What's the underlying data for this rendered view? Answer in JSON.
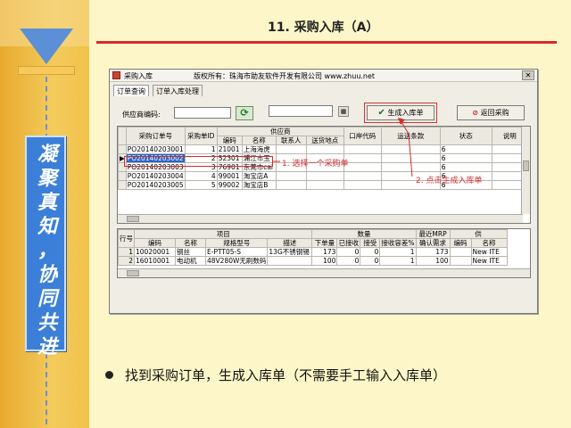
{
  "slide": {
    "title": "11. 采购入库（A）",
    "side_text": [
      "凝",
      "聚",
      "真",
      "知",
      "，",
      "协",
      "同",
      "共",
      "进"
    ],
    "bullet": "找到采购订单，生成入库单（不需要手工输入入库单）"
  },
  "window": {
    "title": "采购入库",
    "copyright": "版权所有：珠海市助友软件开发有限公司 www.zhuu.net",
    "close_glyph": "✕",
    "tabs": [
      "订单查询",
      "订单入库处理"
    ],
    "supplier_label": "供应商编码:",
    "generate_button": "生成入库单",
    "back_button": "返回采购",
    "icons": {
      "refresh": "refresh-icon",
      "calendar": "calendar-icon",
      "check": "check-icon",
      "stop": "stop-icon"
    }
  },
  "orders": {
    "group_header": "供应商",
    "columns": [
      "采购订单号",
      "采购单ID",
      "编码",
      "名称",
      "联系人",
      "送货地点",
      "口岸代码",
      "运送条款",
      "状态",
      "说明"
    ],
    "rows": [
      [
        "PO20140203001",
        "1",
        "21001",
        "上海海虎",
        "",
        "",
        "",
        "",
        "6",
        ""
      ],
      [
        "PO20140203002",
        "2",
        "52301",
        "浦江市玉",
        "",
        "",
        "",
        "",
        "6",
        ""
      ],
      [
        "PO20140203003",
        "3",
        "76901",
        "东莞市cai",
        "",
        "",
        "",
        "",
        "6",
        ""
      ],
      [
        "PO20140203004",
        "4",
        "99001",
        "淘宝店A",
        "",
        "",
        "",
        "",
        "6",
        ""
      ],
      [
        "PO20140203005",
        "5",
        "99002",
        "淘宝店B",
        "",
        "",
        "",
        "",
        "6",
        ""
      ]
    ],
    "selected_row": 1
  },
  "items": {
    "group_headers": [
      "项目",
      "数量",
      "最近MRP",
      "供"
    ],
    "columns": [
      "行号",
      "编码",
      "名称",
      "规格型号",
      "描述",
      "下单量",
      "已接收",
      "接受",
      "接收容差%",
      "确认需求",
      "编码",
      "名称"
    ],
    "rows": [
      [
        "1",
        "10020001",
        "钢丝",
        "E-PTT05-S",
        "13G不锈钢锡",
        "173",
        "0",
        "0",
        "1",
        "173",
        "",
        "New ITE"
      ],
      [
        "2",
        "16010001",
        "电动机",
        "48V280W无刷数码",
        "",
        "100",
        "0",
        "0",
        "1",
        "100",
        "",
        "New ITE"
      ]
    ]
  },
  "annotations": {
    "step1": "1. 选择一个采购单",
    "step2": "2. 点击生成入库单"
  },
  "colors": {
    "accent_red": "#d62b2b",
    "selection_blue": "#2a63c7",
    "side_blue": "#3b7fd8"
  }
}
